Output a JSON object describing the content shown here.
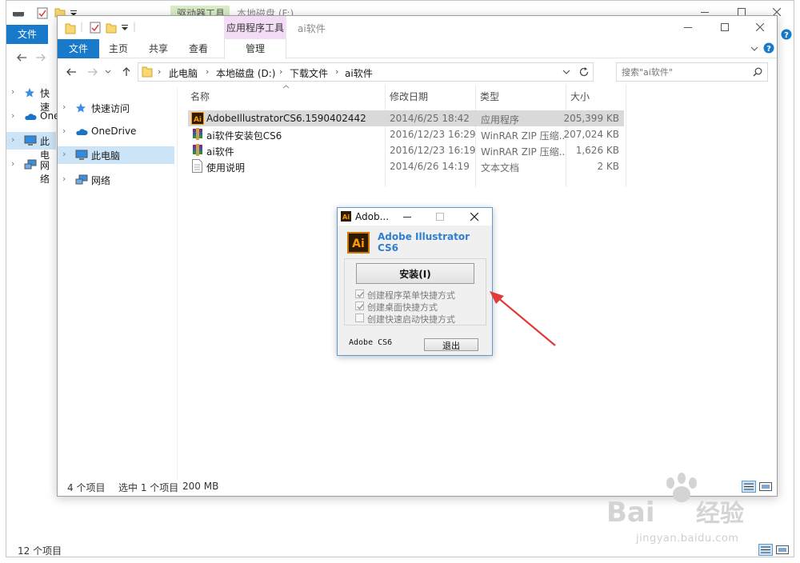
{
  "back_window": {
    "context_tab": "驱动器工具",
    "title": "本地磁盘 (F:)",
    "file_tab": "文件",
    "nav_items": [
      "快速",
      "One",
      "此电",
      "网络"
    ],
    "status_count": "12 个项目"
  },
  "front_window": {
    "context_tab": "应用程序工具",
    "title": "ai软件",
    "ribbon_tabs": [
      "文件",
      "主页",
      "共享",
      "查看",
      "管理"
    ],
    "breadcrumb": [
      "此电脑",
      "本地磁盘 (D:)",
      "下载文件",
      "ai软件"
    ],
    "search_placeholder": "搜索\"ai软件\"",
    "nav_items": [
      {
        "label": "快速访问",
        "icon": "star-icon"
      },
      {
        "label": "OneDrive",
        "icon": "cloud-icon"
      },
      {
        "label": "此电脑",
        "icon": "computer-icon",
        "selected": true
      },
      {
        "label": "网络",
        "icon": "network-icon"
      }
    ],
    "columns": [
      "名称",
      "修改日期",
      "类型",
      "大小"
    ],
    "files": [
      {
        "name": "AdobeIllustratorCS6.1590402442",
        "date": "2014/6/25 18:42",
        "type": "应用程序",
        "size": "205,399 KB",
        "icon": "ai-app-icon",
        "selected": true
      },
      {
        "name": "ai软件安装包CS6",
        "date": "2016/12/23 16:29",
        "type": "WinRAR ZIP 压缩...",
        "size": "207,024 KB",
        "icon": "winrar-icon"
      },
      {
        "name": "ai软件",
        "date": "2016/12/23 16:19",
        "type": "WinRAR ZIP 压缩...",
        "size": "1,626 KB",
        "icon": "winrar-icon"
      },
      {
        "name": "使用说明",
        "date": "2014/6/26 14:19",
        "type": "文本文档",
        "size": "2 KB",
        "icon": "text-file-icon"
      }
    ],
    "status": {
      "count": "4 个项目",
      "selected": "选中 1 个项目",
      "size": "200 MB"
    }
  },
  "installer": {
    "title": "Adob...",
    "product": "Adobe Illustrator CS6",
    "install_label": "安装(I)",
    "options": [
      {
        "label": "创建程序菜单快捷方式",
        "checked": true
      },
      {
        "label": "创建桌面快捷方式",
        "checked": true
      },
      {
        "label": "创建快速启动快捷方式",
        "checked": false
      }
    ],
    "brand": "Adobe CS6",
    "exit_label": "退出"
  },
  "watermark": {
    "logo": "Baidu经验",
    "url": "jingyan.baidu.com"
  },
  "colors": {
    "accent": "#1979ca",
    "selection": "#cce4f7",
    "ai_brand": "#ff9a00",
    "arrow": "#e03a3a"
  }
}
